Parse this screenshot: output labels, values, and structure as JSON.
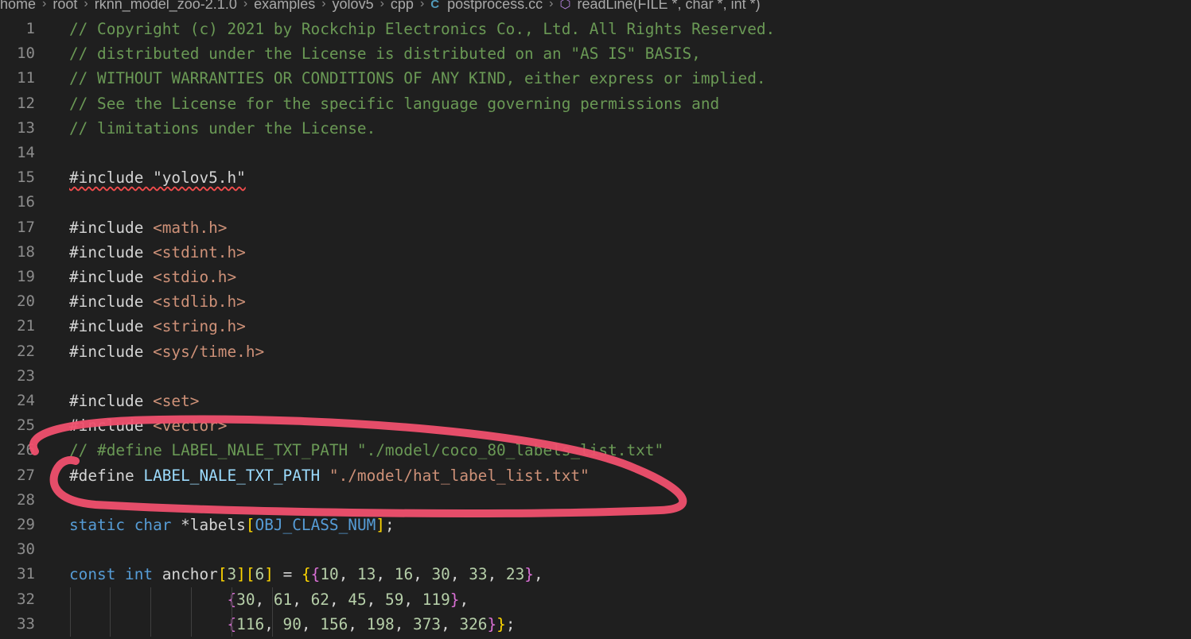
{
  "breadcrumb": {
    "segments": [
      "home",
      "root",
      "rknn_model_zoo-2.1.0",
      "examples",
      "yolov5",
      "cpp",
      "postprocess.cc",
      "readLine(FILE *, char *, int *)"
    ],
    "separator": "›"
  },
  "icons": {
    "file": "cpp-file-icon",
    "symbol": "function-cube-icon"
  },
  "colors": {
    "background": "#1f1f1f",
    "comment": "#6a9955",
    "preprocessor": "#c586c0",
    "string": "#ce9178",
    "keyword": "#569cd6",
    "annotation": "#f0506e"
  },
  "editor": {
    "lines": [
      {
        "n": "1",
        "parts": [
          {
            "t": "// Copyright (c) 2021 by Rockchip Electronics Co., Ltd. All Rights Reserved.",
            "c": "comment"
          }
        ]
      },
      {
        "n": "10",
        "parts": [
          {
            "t": "// distributed under the License is distributed on an \"AS IS\" BASIS,",
            "c": "comment"
          }
        ]
      },
      {
        "n": "11",
        "parts": [
          {
            "t": "// WITHOUT WARRANTIES OR CONDITIONS OF ANY KIND, either express or implied.",
            "c": "comment"
          }
        ]
      },
      {
        "n": "12",
        "parts": [
          {
            "t": "// See the License for the specific language governing permissions and",
            "c": "comment"
          }
        ]
      },
      {
        "n": "13",
        "parts": [
          {
            "t": "// limitations under the License.",
            "c": "comment"
          }
        ]
      },
      {
        "n": "14",
        "parts": []
      },
      {
        "n": "15",
        "parts": [
          {
            "t": "#include \"yolov5.h\"",
            "c": "pp-str-squiggle"
          }
        ]
      },
      {
        "n": "16",
        "parts": []
      },
      {
        "n": "17",
        "parts": [
          {
            "t": "#include ",
            "c": "plain"
          },
          {
            "t": "<math.h>",
            "c": "str"
          }
        ]
      },
      {
        "n": "18",
        "parts": [
          {
            "t": "#include ",
            "c": "plain"
          },
          {
            "t": "<stdint.h>",
            "c": "str"
          }
        ]
      },
      {
        "n": "19",
        "parts": [
          {
            "t": "#include ",
            "c": "plain"
          },
          {
            "t": "<stdio.h>",
            "c": "str"
          }
        ]
      },
      {
        "n": "20",
        "parts": [
          {
            "t": "#include ",
            "c": "plain"
          },
          {
            "t": "<stdlib.h>",
            "c": "str"
          }
        ]
      },
      {
        "n": "21",
        "parts": [
          {
            "t": "#include ",
            "c": "plain"
          },
          {
            "t": "<string.h>",
            "c": "str"
          }
        ]
      },
      {
        "n": "22",
        "parts": [
          {
            "t": "#include ",
            "c": "plain"
          },
          {
            "t": "<sys/time.h>",
            "c": "str"
          }
        ]
      },
      {
        "n": "23",
        "parts": []
      },
      {
        "n": "24",
        "parts": [
          {
            "t": "#include ",
            "c": "plain"
          },
          {
            "t": "<set>",
            "c": "str"
          }
        ]
      },
      {
        "n": "25",
        "parts": [
          {
            "t": "#include ",
            "c": "plain"
          },
          {
            "t": "<vector>",
            "c": "str"
          }
        ]
      },
      {
        "n": "26",
        "parts": [
          {
            "t": "// #define LABEL_NALE_TXT_PATH \"./model/coco_80_labels_list.txt\"",
            "c": "comment"
          }
        ]
      },
      {
        "n": "27",
        "parts": [
          {
            "t": "#define ",
            "c": "plain"
          },
          {
            "t": "LABEL_NALE_TXT_PATH ",
            "c": "ident"
          },
          {
            "t": "\"./model/hat_label_list.txt\"",
            "c": "str"
          }
        ]
      },
      {
        "n": "28",
        "parts": []
      },
      {
        "n": "29",
        "parts": [
          {
            "t": "static ",
            "c": "kw"
          },
          {
            "t": "char ",
            "c": "kw"
          },
          {
            "t": "*labels",
            "c": "plain"
          },
          {
            "t": "[",
            "c": "bracket"
          },
          {
            "t": "OBJ_CLASS_NUM",
            "c": "macro"
          },
          {
            "t": "]",
            "c": "bracket"
          },
          {
            "t": ";",
            "c": "plain"
          }
        ]
      },
      {
        "n": "30",
        "parts": []
      },
      {
        "n": "31",
        "parts": [
          {
            "t": "const ",
            "c": "kw"
          },
          {
            "t": "int ",
            "c": "kw"
          },
          {
            "t": "anchor",
            "c": "plain"
          },
          {
            "t": "[",
            "c": "bracket"
          },
          {
            "t": "3",
            "c": "num"
          },
          {
            "t": "]",
            "c": "bracket"
          },
          {
            "t": "[",
            "c": "bracket"
          },
          {
            "t": "6",
            "c": "num"
          },
          {
            "t": "]",
            "c": "bracket"
          },
          {
            "t": " = ",
            "c": "plain"
          },
          {
            "t": "{",
            "c": "bracket"
          },
          {
            "t": "{",
            "c": "brace"
          },
          {
            "t": "10",
            "c": "num"
          },
          {
            "t": ", ",
            "c": "plain"
          },
          {
            "t": "13",
            "c": "num"
          },
          {
            "t": ", ",
            "c": "plain"
          },
          {
            "t": "16",
            "c": "num"
          },
          {
            "t": ", ",
            "c": "plain"
          },
          {
            "t": "30",
            "c": "num"
          },
          {
            "t": ", ",
            "c": "plain"
          },
          {
            "t": "33",
            "c": "num"
          },
          {
            "t": ", ",
            "c": "plain"
          },
          {
            "t": "23",
            "c": "num"
          },
          {
            "t": "}",
            "c": "brace"
          },
          {
            "t": ",",
            "c": "plain"
          }
        ]
      },
      {
        "n": "32",
        "parts": [
          {
            "t": "                 ",
            "c": "plain"
          },
          {
            "t": "{",
            "c": "brace"
          },
          {
            "t": "30",
            "c": "num"
          },
          {
            "t": ", ",
            "c": "plain"
          },
          {
            "t": "61",
            "c": "num"
          },
          {
            "t": ", ",
            "c": "plain"
          },
          {
            "t": "62",
            "c": "num"
          },
          {
            "t": ", ",
            "c": "plain"
          },
          {
            "t": "45",
            "c": "num"
          },
          {
            "t": ", ",
            "c": "plain"
          },
          {
            "t": "59",
            "c": "num"
          },
          {
            "t": ", ",
            "c": "plain"
          },
          {
            "t": "119",
            "c": "num"
          },
          {
            "t": "}",
            "c": "brace"
          },
          {
            "t": ",",
            "c": "plain"
          }
        ]
      },
      {
        "n": "33",
        "parts": [
          {
            "t": "                 ",
            "c": "plain"
          },
          {
            "t": "{",
            "c": "brace"
          },
          {
            "t": "116",
            "c": "num"
          },
          {
            "t": ", ",
            "c": "plain"
          },
          {
            "t": "90",
            "c": "num"
          },
          {
            "t": ", ",
            "c": "plain"
          },
          {
            "t": "156",
            "c": "num"
          },
          {
            "t": ", ",
            "c": "plain"
          },
          {
            "t": "198",
            "c": "num"
          },
          {
            "t": ", ",
            "c": "plain"
          },
          {
            "t": "373",
            "c": "num"
          },
          {
            "t": ", ",
            "c": "plain"
          },
          {
            "t": "326",
            "c": "num"
          },
          {
            "t": "}",
            "c": "brace"
          },
          {
            "t": "}",
            "c": "bracket"
          },
          {
            "t": ";",
            "c": "plain"
          }
        ]
      }
    ]
  }
}
